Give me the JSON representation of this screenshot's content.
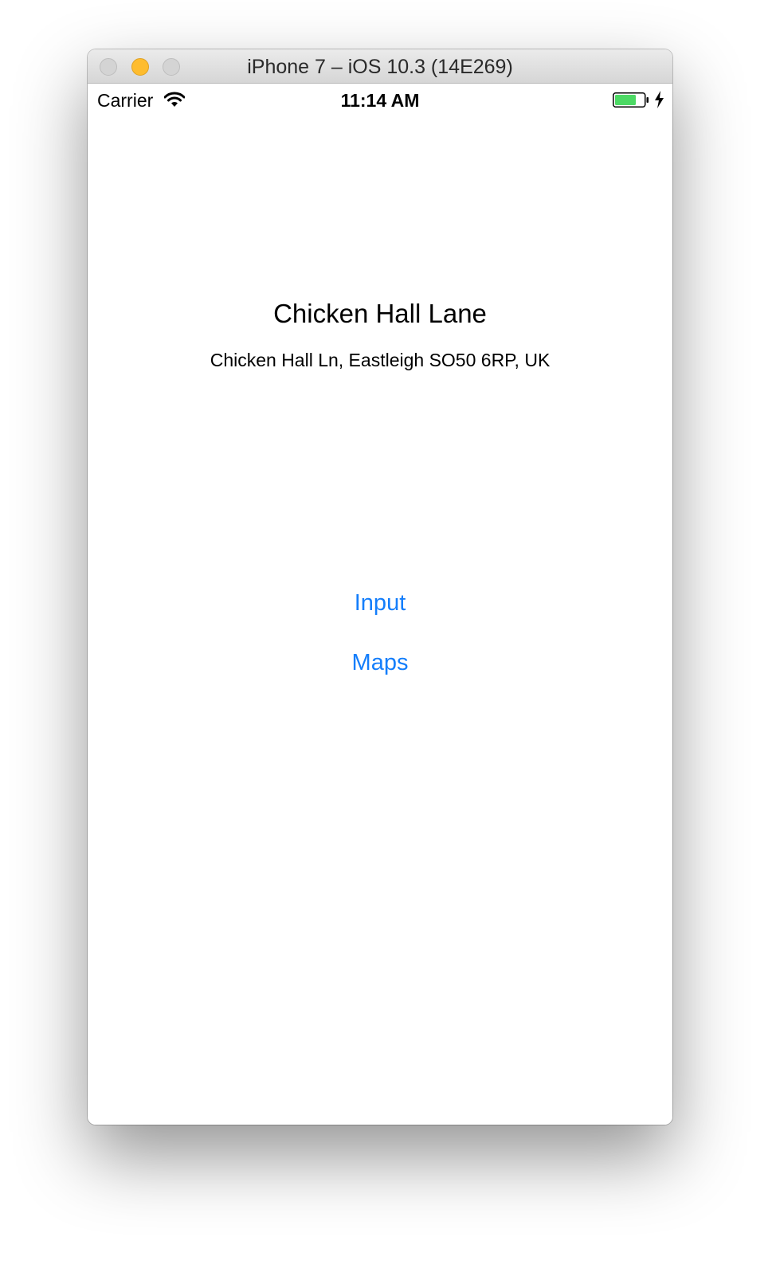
{
  "window": {
    "title": "iPhone 7 – iOS 10.3 (14E269)"
  },
  "status_bar": {
    "carrier": "Carrier",
    "time": "11:14 AM",
    "battery_color": "#4cd964"
  },
  "main": {
    "title": "Chicken Hall Lane",
    "address": "Chicken Hall Ln, Eastleigh SO50 6RP, UK",
    "buttons": {
      "input_label": "Input",
      "maps_label": "Maps"
    },
    "accent_color": "#147efb"
  }
}
